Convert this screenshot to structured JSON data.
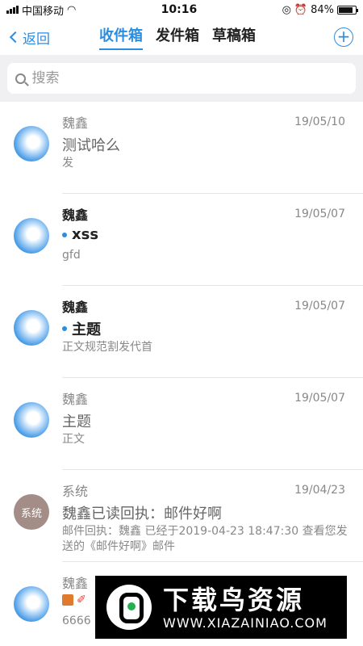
{
  "status": {
    "carrier": "中国移动",
    "time": "10:16",
    "battery": "84%"
  },
  "nav": {
    "back_label": "返回",
    "tabs": [
      "收件箱",
      "发件箱",
      "草稿箱"
    ],
    "add_label": "+"
  },
  "search": {
    "placeholder": "搜索"
  },
  "emails": [
    {
      "sender": "魏鑫",
      "date": "19/05/10",
      "subject": "测试哈么",
      "preview": "发",
      "unread": false
    },
    {
      "sender": "魏鑫",
      "date": "19/05/07",
      "subject": "xss",
      "preview": "gfd",
      "unread": true
    },
    {
      "sender": "魏鑫",
      "date": "19/05/07",
      "subject": "主题",
      "preview": "正文规范割发代首",
      "unread": true
    },
    {
      "sender": "魏鑫",
      "date": "19/05/07",
      "subject": "主题",
      "preview": "正文",
      "unread": false
    },
    {
      "sender": "系统",
      "date": "19/04/23",
      "subject": "魏鑫已读回执：邮件好啊",
      "preview": "邮件回执：魏鑫 已经于2019-04-23 18:47:30 查看您发送的《邮件好啊》邮件",
      "unread": false,
      "avatar_text": "系统"
    },
    {
      "sender": "魏鑫",
      "date": "",
      "subject": "",
      "preview": "6666",
      "unread": false
    }
  ],
  "watermark": {
    "title": "下载鸟资源",
    "url": "WWW.XIAZAINIAO.COM"
  }
}
